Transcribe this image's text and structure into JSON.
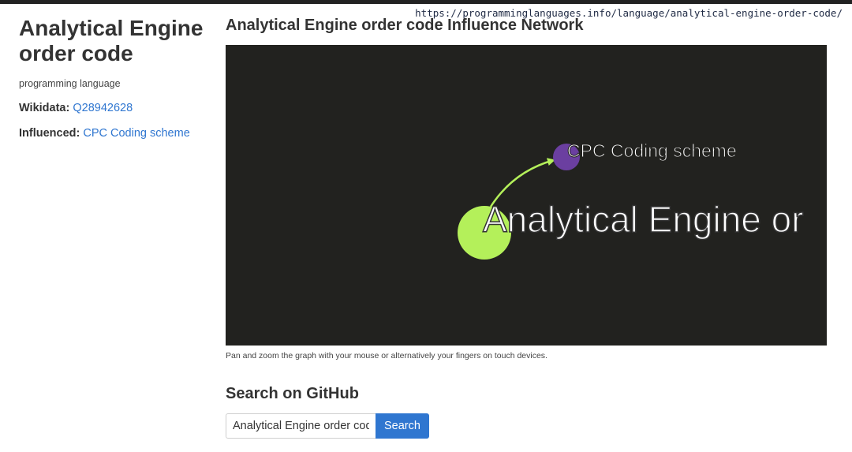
{
  "browser": {
    "url": "https://programminglanguages.info/language/analytical-engine-order-code/"
  },
  "sidebar": {
    "title": "Analytical Engine order code",
    "type": "programming language",
    "wikidata_label": "Wikidata:",
    "wikidata_value": "Q28942628",
    "influenced_label": "Influenced:",
    "influenced_value": "CPC Coding scheme"
  },
  "main": {
    "graph_title": "Analytical Engine order code Influence Network",
    "graph": {
      "background": "#22221f",
      "nodes": [
        {
          "label": "Analytical Engine or",
          "color": "#b4f05a"
        },
        {
          "label": "CPC Coding scheme",
          "color": "#6b3fa0"
        }
      ],
      "edge_color": "#b4f05a"
    },
    "caption": "Pan and zoom the graph with your mouse or alternatively your fingers on touch devices.",
    "github_title": "Search on GitHub",
    "search": {
      "value": "Analytical Engine order cod",
      "button_label": "Search"
    }
  },
  "colors": {
    "link": "#2f76d0",
    "accent_button": "#2f76d0"
  }
}
